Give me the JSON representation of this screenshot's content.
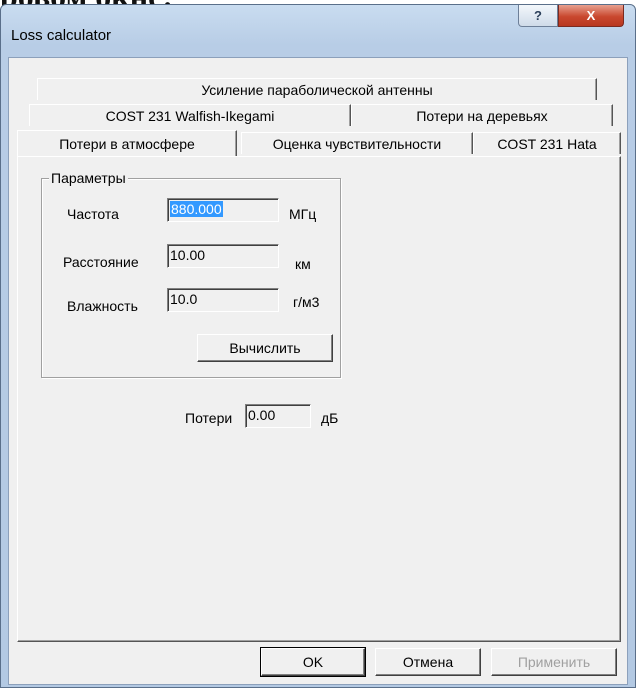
{
  "doc_fragment": "ровом окне:",
  "window": {
    "title": "Loss calculator",
    "help_glyph": "?",
    "close_glyph": "X"
  },
  "tabs": {
    "row1": [
      "Усиление параболической антенны"
    ],
    "row2": [
      "COST 231 Walfish-Ikegami",
      "Потери на деревьях"
    ],
    "row3": [
      "Потери в атмосфере",
      "Оценка чувствительности",
      "COST 231 Hata"
    ],
    "active": "Потери в атмосфере"
  },
  "params": {
    "group_label": "Параметры",
    "frequency": {
      "label": "Частота",
      "value": "880.000",
      "unit": "МГц"
    },
    "distance": {
      "label": "Расстояние",
      "value": "10.00",
      "unit": "км"
    },
    "humidity": {
      "label": "Влажность",
      "value": "10.0",
      "unit": "г/м3"
    },
    "calc_button": "Вычислить"
  },
  "result": {
    "label": "Потери",
    "value": "0.00",
    "unit": "дБ"
  },
  "footer": {
    "ok": "OK",
    "cancel": "Отмена",
    "apply": "Применить"
  }
}
